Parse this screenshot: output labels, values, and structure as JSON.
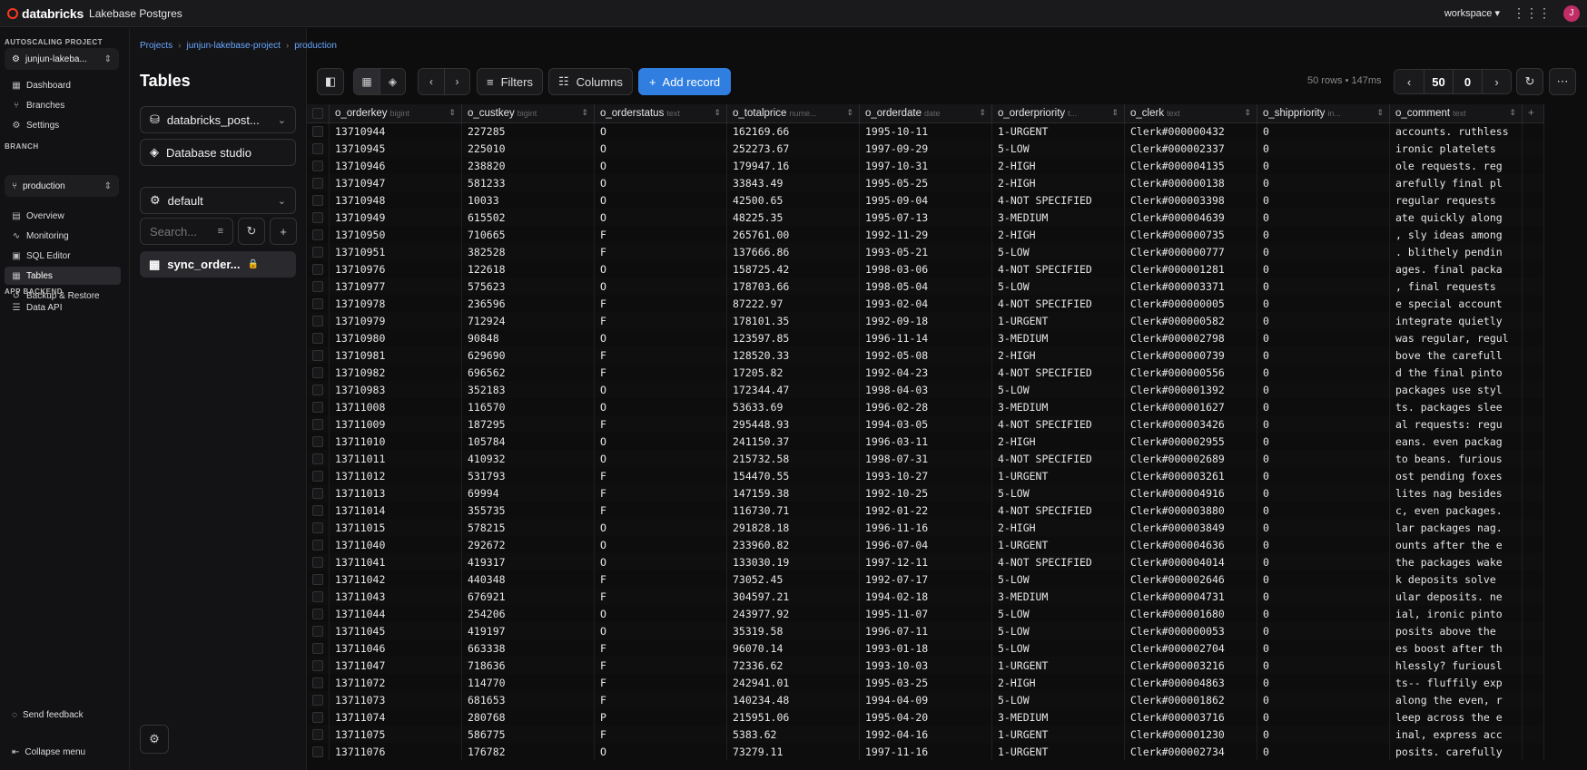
{
  "topbar": {
    "brand": "databricks",
    "product": "Lakebase Postgres",
    "workspace": "workspace",
    "avatar": "J"
  },
  "sidebar": {
    "section_project": "AUTOSCALING PROJECT",
    "project": "junjun-lakeba...",
    "project_nav": [
      {
        "label": "Dashboard",
        "icon": "dashboard-icon"
      },
      {
        "label": "Branches",
        "icon": "branch-icon"
      },
      {
        "label": "Settings",
        "icon": "gear-icon"
      }
    ],
    "section_branch": "BRANCH",
    "branch": "production",
    "branch_nav": [
      {
        "label": "Overview",
        "icon": "overview-icon"
      },
      {
        "label": "Monitoring",
        "icon": "monitor-icon"
      },
      {
        "label": "SQL Editor",
        "icon": "sql-icon"
      },
      {
        "label": "Tables",
        "icon": "table-icon"
      },
      {
        "label": "Backup & Restore",
        "icon": "backup-icon"
      }
    ],
    "section_backend": "APP BACKEND",
    "backend_nav": [
      {
        "label": "Data API",
        "icon": "api-icon"
      }
    ],
    "feedback": "Send feedback",
    "collapse": "Collapse menu"
  },
  "breadcrumb": [
    "Projects",
    "junjun-lakebase-project",
    "production"
  ],
  "tables_panel": {
    "title": "Tables",
    "database": "databricks_post...",
    "studio": "Database studio",
    "schema": "default",
    "search_placeholder": "Search...",
    "table": "sync_order..."
  },
  "toolbar": {
    "filters": "Filters",
    "columns": "Columns",
    "add_record": "Add record"
  },
  "stats": {
    "rows": "50 rows",
    "time": "147ms"
  },
  "pager": {
    "limit": "50",
    "offset": "0"
  },
  "columns": [
    {
      "name": "o_orderkey",
      "type": "bigint"
    },
    {
      "name": "o_custkey",
      "type": "bigint"
    },
    {
      "name": "o_orderstatus",
      "type": "text"
    },
    {
      "name": "o_totalprice",
      "type": "nume..."
    },
    {
      "name": "o_orderdate",
      "type": "date"
    },
    {
      "name": "o_orderpriority",
      "type": "t..."
    },
    {
      "name": "o_clerk",
      "type": "text"
    },
    {
      "name": "o_shippriority",
      "type": "in..."
    },
    {
      "name": "o_comment",
      "type": "text"
    }
  ],
  "rows": [
    [
      "13710944",
      "227285",
      "O",
      "162169.66",
      "1995-10-11",
      "1-URGENT",
      "Clerk#000000432",
      "0",
      "accounts. ruthless"
    ],
    [
      "13710945",
      "225010",
      "O",
      "252273.67",
      "1997-09-29",
      "5-LOW",
      "Clerk#000002337",
      "0",
      "ironic platelets"
    ],
    [
      "13710946",
      "238820",
      "O",
      "179947.16",
      "1997-10-31",
      "2-HIGH",
      "Clerk#000004135",
      "0",
      "ole requests. reg"
    ],
    [
      "13710947",
      "581233",
      "O",
      "33843.49",
      "1995-05-25",
      "2-HIGH",
      "Clerk#000000138",
      "0",
      "arefully final pl"
    ],
    [
      "13710948",
      "10033",
      "O",
      "42500.65",
      "1995-09-04",
      "4-NOT SPECIFIED",
      "Clerk#000003398",
      "0",
      "regular requests"
    ],
    [
      "13710949",
      "615502",
      "O",
      "48225.35",
      "1995-07-13",
      "3-MEDIUM",
      "Clerk#000004639",
      "0",
      "ate quickly along"
    ],
    [
      "13710950",
      "710665",
      "F",
      "265761.00",
      "1992-11-29",
      "2-HIGH",
      "Clerk#000000735",
      "0",
      ", sly ideas among"
    ],
    [
      "13710951",
      "382528",
      "F",
      "137666.86",
      "1993-05-21",
      "5-LOW",
      "Clerk#000000777",
      "0",
      ". blithely pendin"
    ],
    [
      "13710976",
      "122618",
      "O",
      "158725.42",
      "1998-03-06",
      "4-NOT SPECIFIED",
      "Clerk#000001281",
      "0",
      "ages. final packa"
    ],
    [
      "13710977",
      "575623",
      "O",
      "178703.66",
      "1998-05-04",
      "5-LOW",
      "Clerk#000003371",
      "0",
      ", final requests"
    ],
    [
      "13710978",
      "236596",
      "F",
      "87222.97",
      "1993-02-04",
      "4-NOT SPECIFIED",
      "Clerk#000000005",
      "0",
      "e special account"
    ],
    [
      "13710979",
      "712924",
      "F",
      "178101.35",
      "1992-09-18",
      "1-URGENT",
      "Clerk#000000582",
      "0",
      "integrate quietly"
    ],
    [
      "13710980",
      "90848",
      "O",
      "123597.85",
      "1996-11-14",
      "3-MEDIUM",
      "Clerk#000002798",
      "0",
      "was regular, regul"
    ],
    [
      "13710981",
      "629690",
      "F",
      "128520.33",
      "1992-05-08",
      "2-HIGH",
      "Clerk#000000739",
      "0",
      "bove the carefull"
    ],
    [
      "13710982",
      "696562",
      "F",
      "17205.82",
      "1992-04-23",
      "4-NOT SPECIFIED",
      "Clerk#000000556",
      "0",
      "d the final pinto"
    ],
    [
      "13710983",
      "352183",
      "O",
      "172344.47",
      "1998-04-03",
      "5-LOW",
      "Clerk#000001392",
      "0",
      "packages use styl"
    ],
    [
      "13711008",
      "116570",
      "O",
      "53633.69",
      "1996-02-28",
      "3-MEDIUM",
      "Clerk#000001627",
      "0",
      "ts. packages slee"
    ],
    [
      "13711009",
      "187295",
      "F",
      "295448.93",
      "1994-03-05",
      "4-NOT SPECIFIED",
      "Clerk#000003426",
      "0",
      "al requests: regu"
    ],
    [
      "13711010",
      "105784",
      "O",
      "241150.37",
      "1996-03-11",
      "2-HIGH",
      "Clerk#000002955",
      "0",
      "eans. even packag"
    ],
    [
      "13711011",
      "410932",
      "O",
      "215732.58",
      "1998-07-31",
      "4-NOT SPECIFIED",
      "Clerk#000002689",
      "0",
      "to beans. furious"
    ],
    [
      "13711012",
      "531793",
      "F",
      "154470.55",
      "1993-10-27",
      "1-URGENT",
      "Clerk#000003261",
      "0",
      "ost pending foxes"
    ],
    [
      "13711013",
      "69994",
      "F",
      "147159.38",
      "1992-10-25",
      "5-LOW",
      "Clerk#000004916",
      "0",
      "lites nag besides"
    ],
    [
      "13711014",
      "355735",
      "F",
      "116730.71",
      "1992-01-22",
      "4-NOT SPECIFIED",
      "Clerk#000003880",
      "0",
      "c, even packages."
    ],
    [
      "13711015",
      "578215",
      "O",
      "291828.18",
      "1996-11-16",
      "2-HIGH",
      "Clerk#000003849",
      "0",
      "lar packages nag."
    ],
    [
      "13711040",
      "292672",
      "O",
      "233960.82",
      "1996-07-04",
      "1-URGENT",
      "Clerk#000004636",
      "0",
      "ounts after the e"
    ],
    [
      "13711041",
      "419317",
      "O",
      "133030.19",
      "1997-12-11",
      "4-NOT SPECIFIED",
      "Clerk#000004014",
      "0",
      "the packages wake"
    ],
    [
      "13711042",
      "440348",
      "F",
      "73052.45",
      "1992-07-17",
      "5-LOW",
      "Clerk#000002646",
      "0",
      "k deposits solve"
    ],
    [
      "13711043",
      "676921",
      "F",
      "304597.21",
      "1994-02-18",
      "3-MEDIUM",
      "Clerk#000004731",
      "0",
      "ular deposits. ne"
    ],
    [
      "13711044",
      "254206",
      "O",
      "243977.92",
      "1995-11-07",
      "5-LOW",
      "Clerk#000001680",
      "0",
      "ial, ironic pinto"
    ],
    [
      "13711045",
      "419197",
      "O",
      "35319.58",
      "1996-07-11",
      "5-LOW",
      "Clerk#000000053",
      "0",
      "posits above the"
    ],
    [
      "13711046",
      "663338",
      "F",
      "96070.14",
      "1993-01-18",
      "5-LOW",
      "Clerk#000002704",
      "0",
      "es boost after th"
    ],
    [
      "13711047",
      "718636",
      "F",
      "72336.62",
      "1993-10-03",
      "1-URGENT",
      "Clerk#000003216",
      "0",
      "hlessly? furiousl"
    ],
    [
      "13711072",
      "114770",
      "F",
      "242941.01",
      "1995-03-25",
      "2-HIGH",
      "Clerk#000004863",
      "0",
      "ts-- fluffily exp"
    ],
    [
      "13711073",
      "681653",
      "F",
      "140234.48",
      "1994-04-09",
      "5-LOW",
      "Clerk#000001862",
      "0",
      "along the even, r"
    ],
    [
      "13711074",
      "280768",
      "P",
      "215951.06",
      "1995-04-20",
      "3-MEDIUM",
      "Clerk#000003716",
      "0",
      "leep across the e"
    ],
    [
      "13711075",
      "586775",
      "F",
      "5383.62",
      "1992-04-16",
      "1-URGENT",
      "Clerk#000001230",
      "0",
      "inal, express acc"
    ],
    [
      "13711076",
      "176782",
      "O",
      "73279.11",
      "1997-11-16",
      "1-URGENT",
      "Clerk#000002734",
      "0",
      "posits. carefully"
    ]
  ]
}
